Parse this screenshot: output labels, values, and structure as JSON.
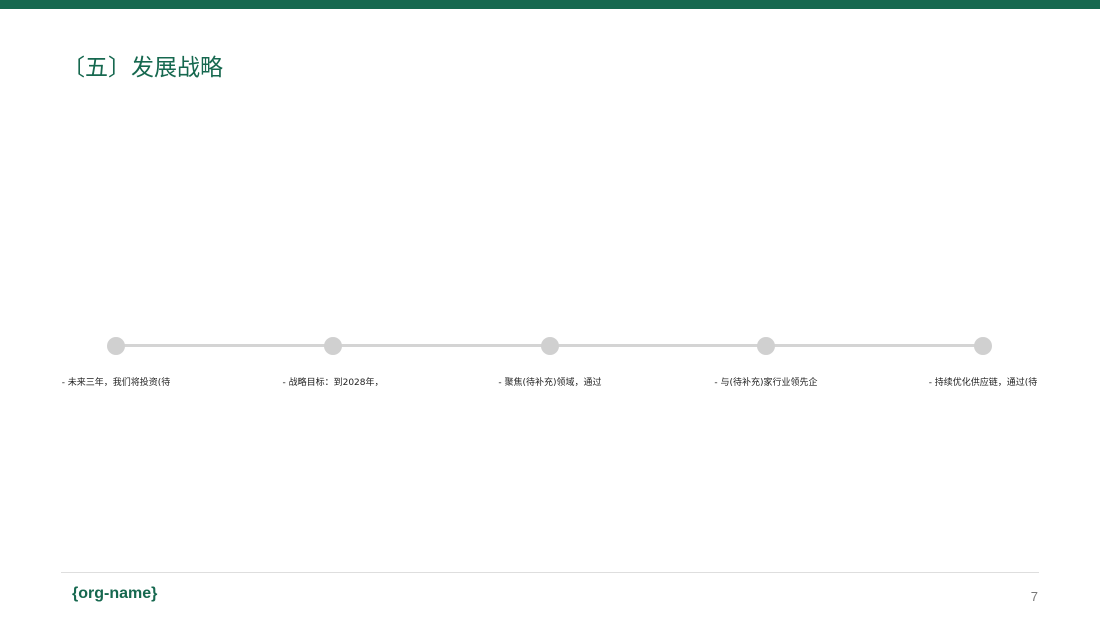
{
  "header": {
    "title": "〔五〕发展战略"
  },
  "timeline": {
    "items": [
      {
        "text": "- 未来三年，我们将投资(待"
      },
      {
        "text": "- 战略目标：到2028年，"
      },
      {
        "text": "- 聚焦(待补充)领域，通过"
      },
      {
        "text": "- 与(待补充)家行业领先企"
      },
      {
        "text": "- 持续优化供应链，通过(待"
      }
    ]
  },
  "footer": {
    "org_name": "{org-name}",
    "page_number": "7"
  },
  "colors": {
    "accent": "#16684f",
    "timeline_line": "#d4d4d4",
    "timeline_dot": "#d0d0d0"
  }
}
